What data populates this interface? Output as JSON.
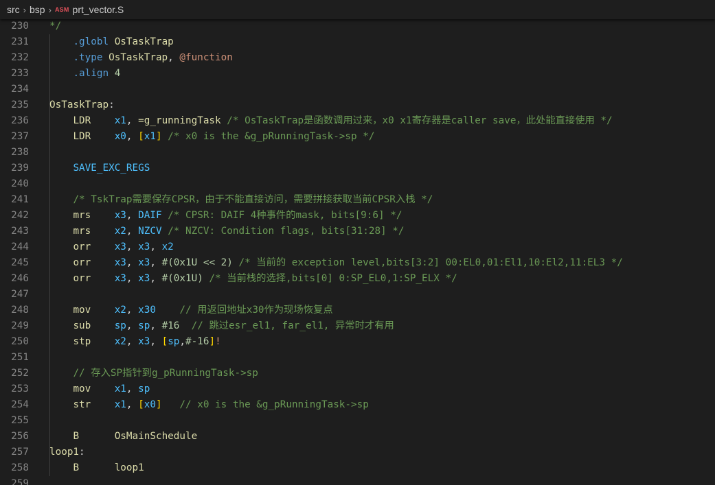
{
  "breadcrumb": {
    "items": [
      "src",
      "bsp"
    ],
    "file_badge": "ASM",
    "file_name": "prt_vector.S"
  },
  "colors": {
    "background": "#1e1e1e",
    "line_number": "#858585",
    "directive": "#569cd6",
    "label": "#dcdcaa",
    "register": "#4fc1ff",
    "comment": "#6a9955",
    "number": "#b5cea8",
    "bracket": "#ffd700"
  },
  "lines": [
    {
      "num": "230",
      "tokens": [
        {
          "t": "*/",
          "c": "cmt"
        }
      ]
    },
    {
      "num": "231",
      "tokens": [
        {
          "t": "    "
        },
        {
          "t": ".globl",
          "c": "dir"
        },
        {
          "t": " "
        },
        {
          "t": "OsTaskTrap",
          "c": "lbl"
        }
      ]
    },
    {
      "num": "232",
      "tokens": [
        {
          "t": "    "
        },
        {
          "t": ".type",
          "c": "dir"
        },
        {
          "t": " "
        },
        {
          "t": "OsTaskTrap",
          "c": "lbl"
        },
        {
          "t": ", "
        },
        {
          "t": "@function",
          "c": "at"
        }
      ]
    },
    {
      "num": "233",
      "tokens": [
        {
          "t": "    "
        },
        {
          "t": ".align",
          "c": "dir"
        },
        {
          "t": " "
        },
        {
          "t": "4",
          "c": "num"
        }
      ]
    },
    {
      "num": "234",
      "tokens": []
    },
    {
      "num": "235",
      "tokens": [
        {
          "t": "OsTaskTrap",
          "c": "lbl"
        },
        {
          "t": ":"
        }
      ]
    },
    {
      "num": "236",
      "tokens": [
        {
          "t": "    "
        },
        {
          "t": "LDR",
          "c": "op"
        },
        {
          "t": "    "
        },
        {
          "t": "x1",
          "c": "reg"
        },
        {
          "t": ", "
        },
        {
          "t": "=g_runningTask",
          "c": "lbl"
        },
        {
          "t": " "
        },
        {
          "t": "/* OsTaskTrap是函数调用过来，x0 x1寄存器是caller save，此处能直接使用 */",
          "c": "cmt"
        }
      ]
    },
    {
      "num": "237",
      "tokens": [
        {
          "t": "    "
        },
        {
          "t": "LDR",
          "c": "op"
        },
        {
          "t": "    "
        },
        {
          "t": "x0",
          "c": "reg"
        },
        {
          "t": ", "
        },
        {
          "t": "[",
          "c": "brk"
        },
        {
          "t": "x1",
          "c": "reg"
        },
        {
          "t": "]",
          "c": "brk"
        },
        {
          "t": " "
        },
        {
          "t": "/* x0 is the &g_pRunningTask->sp */",
          "c": "cmt"
        }
      ]
    },
    {
      "num": "238",
      "tokens": []
    },
    {
      "num": "239",
      "tokens": [
        {
          "t": "    "
        },
        {
          "t": "SAVE_EXC_REGS",
          "c": "reg"
        }
      ]
    },
    {
      "num": "240",
      "tokens": []
    },
    {
      "num": "241",
      "tokens": [
        {
          "t": "    "
        },
        {
          "t": "/* TskTrap需要保存CPSR，由于不能直接访问，需要拼接获取当前CPSR入栈 */",
          "c": "cmt"
        }
      ]
    },
    {
      "num": "242",
      "tokens": [
        {
          "t": "    "
        },
        {
          "t": "mrs",
          "c": "op"
        },
        {
          "t": "    "
        },
        {
          "t": "x3",
          "c": "reg"
        },
        {
          "t": ", "
        },
        {
          "t": "DAIF",
          "c": "reg"
        },
        {
          "t": " "
        },
        {
          "t": "/* CPSR: DAIF 4种事件的mask, bits[9:6] */",
          "c": "cmt"
        }
      ]
    },
    {
      "num": "243",
      "tokens": [
        {
          "t": "    "
        },
        {
          "t": "mrs",
          "c": "op"
        },
        {
          "t": "    "
        },
        {
          "t": "x2",
          "c": "reg"
        },
        {
          "t": ", "
        },
        {
          "t": "NZCV",
          "c": "reg"
        },
        {
          "t": " "
        },
        {
          "t": "/* NZCV: Condition flags, bits[31:28] */",
          "c": "cmt"
        }
      ]
    },
    {
      "num": "244",
      "tokens": [
        {
          "t": "    "
        },
        {
          "t": "orr",
          "c": "op"
        },
        {
          "t": "    "
        },
        {
          "t": "x3",
          "c": "reg"
        },
        {
          "t": ", "
        },
        {
          "t": "x3",
          "c": "reg"
        },
        {
          "t": ", "
        },
        {
          "t": "x2",
          "c": "reg"
        }
      ]
    },
    {
      "num": "245",
      "tokens": [
        {
          "t": "    "
        },
        {
          "t": "orr",
          "c": "op"
        },
        {
          "t": "    "
        },
        {
          "t": "x3",
          "c": "reg"
        },
        {
          "t": ", "
        },
        {
          "t": "x3",
          "c": "reg"
        },
        {
          "t": ", "
        },
        {
          "t": "#(0x1U << 2)",
          "c": "num"
        },
        {
          "t": " "
        },
        {
          "t": "/* 当前的 exception level,bits[3:2] 00:EL0,01:El1,10:El2,11:EL3 */",
          "c": "cmt"
        }
      ]
    },
    {
      "num": "246",
      "tokens": [
        {
          "t": "    "
        },
        {
          "t": "orr",
          "c": "op"
        },
        {
          "t": "    "
        },
        {
          "t": "x3",
          "c": "reg"
        },
        {
          "t": ", "
        },
        {
          "t": "x3",
          "c": "reg"
        },
        {
          "t": ", "
        },
        {
          "t": "#(0x1U)",
          "c": "num"
        },
        {
          "t": " "
        },
        {
          "t": "/* 当前栈的选择,bits[0] 0:SP_EL0,1:SP_ELX */",
          "c": "cmt"
        }
      ]
    },
    {
      "num": "247",
      "tokens": []
    },
    {
      "num": "248",
      "tokens": [
        {
          "t": "    "
        },
        {
          "t": "mov",
          "c": "op"
        },
        {
          "t": "    "
        },
        {
          "t": "x2",
          "c": "reg"
        },
        {
          "t": ", "
        },
        {
          "t": "x30",
          "c": "reg"
        },
        {
          "t": "    "
        },
        {
          "t": "// 用返回地址x30作为现场恢复点",
          "c": "cmt"
        }
      ]
    },
    {
      "num": "249",
      "tokens": [
        {
          "t": "    "
        },
        {
          "t": "sub",
          "c": "op"
        },
        {
          "t": "    "
        },
        {
          "t": "sp",
          "c": "reg"
        },
        {
          "t": ", "
        },
        {
          "t": "sp",
          "c": "reg"
        },
        {
          "t": ", "
        },
        {
          "t": "#16",
          "c": "num"
        },
        {
          "t": "  "
        },
        {
          "t": "// 跳过esr_el1, far_el1, 异常时才有用",
          "c": "cmt"
        }
      ]
    },
    {
      "num": "250",
      "tokens": [
        {
          "t": "    "
        },
        {
          "t": "stp",
          "c": "op"
        },
        {
          "t": "    "
        },
        {
          "t": "x2",
          "c": "reg"
        },
        {
          "t": ", "
        },
        {
          "t": "x3",
          "c": "reg"
        },
        {
          "t": ", "
        },
        {
          "t": "[",
          "c": "brk"
        },
        {
          "t": "sp",
          "c": "reg"
        },
        {
          "t": ","
        },
        {
          "t": "#-16",
          "c": "num"
        },
        {
          "t": "]",
          "c": "brk"
        },
        {
          "t": "!",
          "c": "at"
        }
      ]
    },
    {
      "num": "251",
      "tokens": []
    },
    {
      "num": "252",
      "tokens": [
        {
          "t": "    "
        },
        {
          "t": "// 存入SP指针到g_pRunningTask->sp",
          "c": "cmt"
        }
      ]
    },
    {
      "num": "253",
      "tokens": [
        {
          "t": "    "
        },
        {
          "t": "mov",
          "c": "op"
        },
        {
          "t": "    "
        },
        {
          "t": "x1",
          "c": "reg"
        },
        {
          "t": ", "
        },
        {
          "t": "sp",
          "c": "reg"
        }
      ]
    },
    {
      "num": "254",
      "tokens": [
        {
          "t": "    "
        },
        {
          "t": "str",
          "c": "op"
        },
        {
          "t": "    "
        },
        {
          "t": "x1",
          "c": "reg"
        },
        {
          "t": ", "
        },
        {
          "t": "[",
          "c": "brk"
        },
        {
          "t": "x0",
          "c": "reg"
        },
        {
          "t": "]",
          "c": "brk"
        },
        {
          "t": "   "
        },
        {
          "t": "// x0 is the &g_pRunningTask->sp",
          "c": "cmt"
        }
      ]
    },
    {
      "num": "255",
      "tokens": []
    },
    {
      "num": "256",
      "tokens": [
        {
          "t": "    "
        },
        {
          "t": "B",
          "c": "op"
        },
        {
          "t": "      "
        },
        {
          "t": "OsMainSchedule",
          "c": "lbl"
        }
      ]
    },
    {
      "num": "257",
      "tokens": [
        {
          "t": "loop1",
          "c": "lbl"
        },
        {
          "t": ":"
        }
      ]
    },
    {
      "num": "258",
      "tokens": [
        {
          "t": "    "
        },
        {
          "t": "B",
          "c": "op"
        },
        {
          "t": "      "
        },
        {
          "t": "loop1",
          "c": "lbl"
        }
      ]
    },
    {
      "num": "259",
      "tokens": []
    }
  ]
}
